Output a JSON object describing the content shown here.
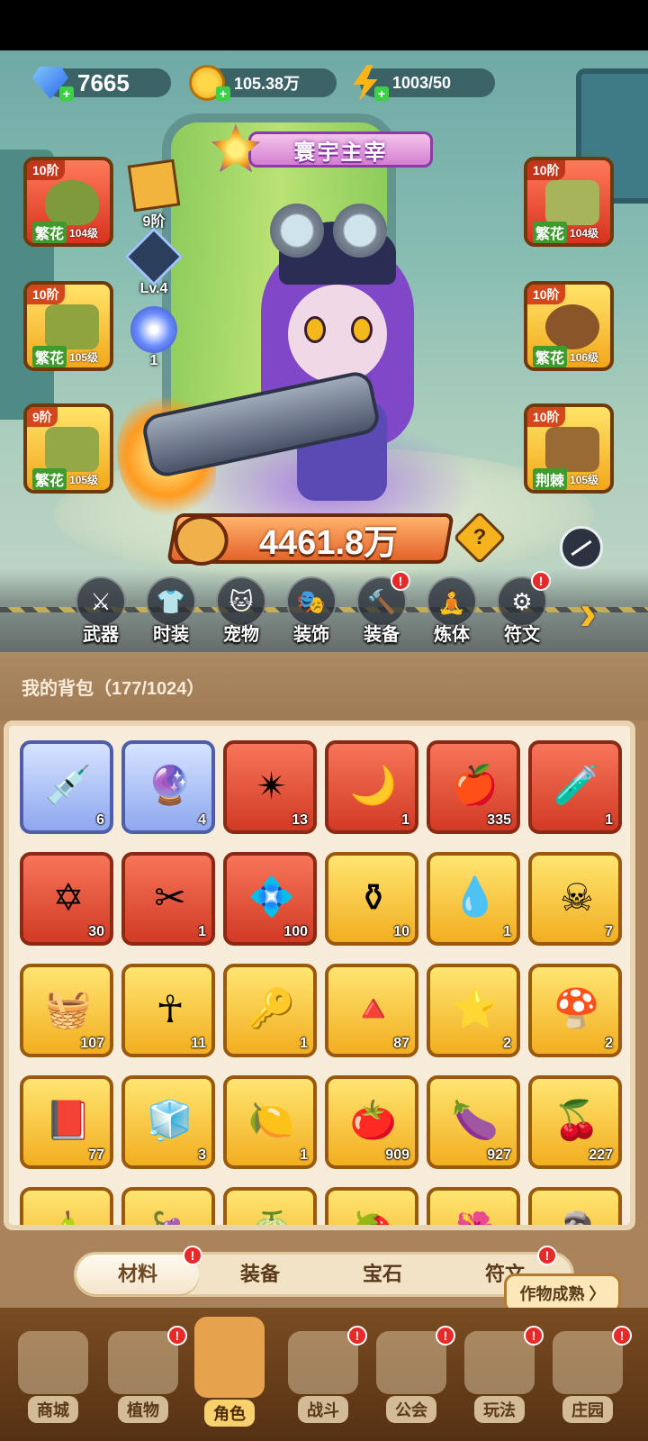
{
  "currency": {
    "gems": "7665",
    "gold": "105.38万",
    "energy": "1003/50"
  },
  "title_banner": "寰宇主宰",
  "equipment_left": [
    {
      "tier": "10阶",
      "quality": "繁花",
      "level": "104级",
      "color": "red"
    },
    {
      "tier": "10阶",
      "quality": "繁花",
      "level": "105级",
      "color": "gold"
    },
    {
      "tier": "9阶",
      "quality": "繁花",
      "level": "105级",
      "color": "gold"
    }
  ],
  "equipment_right": [
    {
      "tier": "10阶",
      "quality": "繁花",
      "level": "104级",
      "color": "red"
    },
    {
      "tier": "10阶",
      "quality": "繁花",
      "level": "106级",
      "color": "gold"
    },
    {
      "tier": "10阶",
      "quality": "荆棘",
      "level": "105级",
      "color": "gold"
    }
  ],
  "mini_column": {
    "stage": "9阶",
    "level": "Lv.4",
    "orb_count": "1"
  },
  "power": "4461.8万",
  "help": "?",
  "categories": [
    "武器",
    "时装",
    "宠物",
    "装饰",
    "装备",
    "炼体",
    "符文"
  ],
  "category_alerts": {
    "装备": "!",
    "符文": "!"
  },
  "bag_title": "我的背包（177/1024）",
  "bag_items": [
    {
      "count": "6",
      "rarity": "blue",
      "icon": "syringe-icon"
    },
    {
      "count": "4",
      "rarity": "blue",
      "icon": "orb-ring-icon"
    },
    {
      "count": "13",
      "rarity": "red",
      "icon": "crystal-star-icon"
    },
    {
      "count": "1",
      "rarity": "red",
      "icon": "moon-gem-icon"
    },
    {
      "count": "335",
      "rarity": "red",
      "icon": "red-potion-icon"
    },
    {
      "count": "1",
      "rarity": "red",
      "icon": "green-vial-icon"
    },
    {
      "count": "30",
      "rarity": "red",
      "icon": "hexagram-crystal-icon"
    },
    {
      "count": "1",
      "rarity": "red",
      "icon": "scissors-icon"
    },
    {
      "count": "100",
      "rarity": "red",
      "icon": "purple-cube-icon"
    },
    {
      "count": "10",
      "rarity": "gold",
      "icon": "gold-flask-icon"
    },
    {
      "count": "1",
      "rarity": "gold",
      "icon": "water-drop-icon"
    },
    {
      "count": "7",
      "rarity": "gold",
      "icon": "skull-scroll-icon"
    },
    {
      "count": "107",
      "rarity": "gold",
      "icon": "basket-icon"
    },
    {
      "count": "11",
      "rarity": "gold",
      "icon": "ankh-icon"
    },
    {
      "count": "1",
      "rarity": "gold",
      "icon": "key-icon"
    },
    {
      "count": "87",
      "rarity": "gold",
      "icon": "prism-icon"
    },
    {
      "count": "2",
      "rarity": "gold",
      "icon": "star-compass-icon"
    },
    {
      "count": "2",
      "rarity": "gold",
      "icon": "mushroom-icon"
    },
    {
      "count": "77",
      "rarity": "gold",
      "icon": "book-icon"
    },
    {
      "count": "3",
      "rarity": "gold",
      "icon": "green-cube-icon"
    },
    {
      "count": "1",
      "rarity": "gold",
      "icon": "lemon-icon"
    },
    {
      "count": "909",
      "rarity": "gold",
      "icon": "tomato-basket-icon"
    },
    {
      "count": "927",
      "rarity": "gold",
      "icon": "eggplant-basket-icon"
    },
    {
      "count": "227",
      "rarity": "gold",
      "icon": "berry-basket-icon"
    },
    {
      "count": "",
      "rarity": "gold",
      "icon": "pear-icon"
    },
    {
      "count": "",
      "rarity": "gold",
      "icon": "grape-icon"
    },
    {
      "count": "",
      "rarity": "gold",
      "icon": "melon-icon"
    },
    {
      "count": "",
      "rarity": "gold",
      "icon": "strawberry-icon"
    },
    {
      "count": "",
      "rarity": "gold",
      "icon": "flower-icon"
    },
    {
      "count": "",
      "rarity": "gold",
      "icon": "rune-stone-icon"
    }
  ],
  "subtabs": [
    "材料",
    "装备",
    "宝石",
    "符文"
  ],
  "subtab_alerts": {
    "材料": "!",
    "符文": "!"
  },
  "crop_ready": "作物成熟 〉",
  "bottom_nav": [
    "商城",
    "植物",
    "角色",
    "战斗",
    "公会",
    "玩法",
    "庄园"
  ],
  "bottom_nav_active": "角色",
  "colors": {
    "bag_bg": "#a9835b",
    "panel": "#f7ecd9",
    "accent_gold": "#f5b31e"
  }
}
